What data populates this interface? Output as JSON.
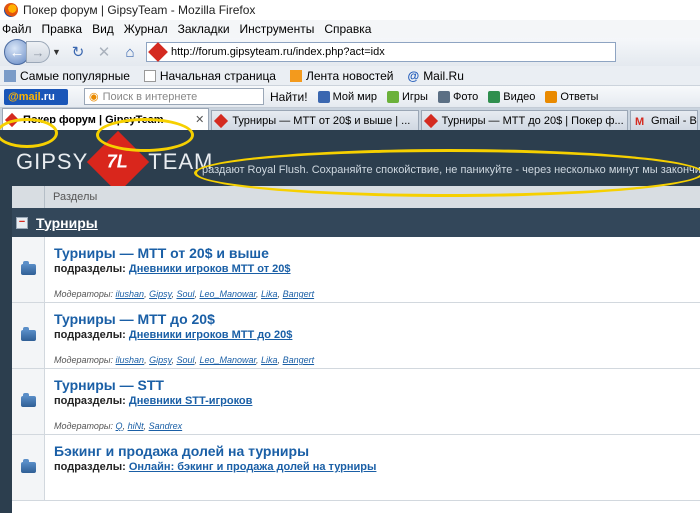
{
  "window": {
    "title": "Покер форум | GipsyTeam - Mozilla Firefox"
  },
  "menu": [
    "Файл",
    "Правка",
    "Вид",
    "Журнал",
    "Закладки",
    "Инструменты",
    "Справка"
  ],
  "nav": {
    "url": "http://forum.gipsyteam.ru/index.php?act=idx"
  },
  "bookmarks": [
    "Самые популярные",
    "Начальная страница",
    "Лента новостей",
    "Mail.Ru"
  ],
  "mailbar": {
    "logo_at": "@mail",
    "logo_ru": ".ru",
    "search_placeholder": "Поиск в интернете",
    "find": "Найти!",
    "items": [
      "Мой мир",
      "Игры",
      "Фото",
      "Видео",
      "Ответы"
    ]
  },
  "tabs": [
    {
      "label": "Покер форум | GipsyTeam",
      "active": true
    },
    {
      "label": "Турниры — МТТ от 20$ и выше | ...",
      "active": false
    },
    {
      "label": "Турниры — МТТ до 20$ | Покер ф...",
      "active": false
    },
    {
      "label": "Gmail - Вх",
      "active": false
    }
  ],
  "site": {
    "logo_left": "GIPSY",
    "logo_mark": "7L",
    "logo_right": "TEAM",
    "ticker": "раздают Royal Flush. Сохраняйте спокойствие, не паникуйте - через несколько минут мы закончим рабо"
  },
  "forum": {
    "sections_label": "Разделы",
    "category": "Турниры",
    "subs_label": "подразделы:",
    "mods_label": "Модераторы:",
    "rows": [
      {
        "title": "Турниры — МТТ от 20$ и выше",
        "sub": "Дневники игроков МТТ от 20$",
        "mods": [
          "ilushan",
          "Gipsy",
          "Soul",
          "Leo_Manowar",
          "Lika",
          "Bangert"
        ]
      },
      {
        "title": "Турниры — МТТ до 20$",
        "sub": "Дневники игроков МТТ до 20$",
        "mods": [
          "ilushan",
          "Gipsy",
          "Soul",
          "Leo_Manowar",
          "Lika",
          "Bangert"
        ]
      },
      {
        "title": "Турниры — STT",
        "sub": "Дневники STT-игроков",
        "mods": [
          "Q",
          "hiNt",
          "Sandrex"
        ]
      },
      {
        "title": "Бэкинг и продажа долей на турниры",
        "sub": "Онлайн: бэкинг и продажа долей на турниры",
        "mods": []
      }
    ]
  },
  "colors": {
    "highlight": "#f6d000",
    "header_bg": "#2c3e4e",
    "link": "#1a5fa6",
    "brand_red": "#d9261c"
  }
}
